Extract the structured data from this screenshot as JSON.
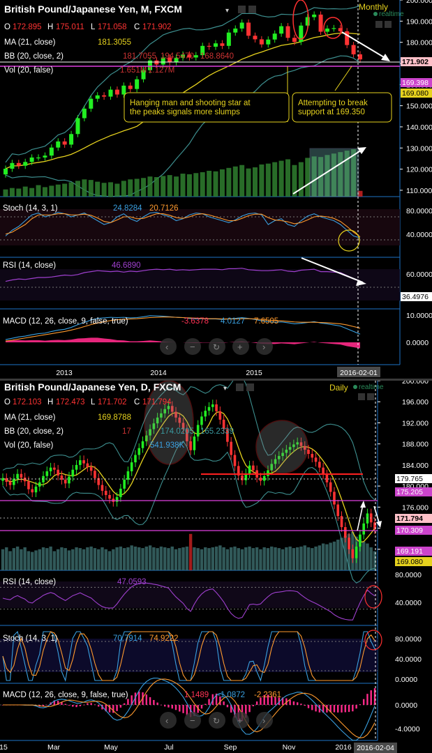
{
  "colors": {
    "up": "#22ee22",
    "down": "#ff3333",
    "ma": "#e6d21e",
    "bb": "#3d8f8f",
    "vol": "#2f8f2f",
    "stoch_k": "#3aa0e0",
    "stoch_d": "#ff9a2e",
    "rsi": "#a040d0",
    "macd_hist": "#ff2a8a",
    "support": "#ff2020",
    "level": "#e040e0",
    "note": "#e6d21e",
    "axis": "#1e73c8",
    "price_tag": "#ffc0c8"
  },
  "chart_data": [
    {
      "type": "candlestick",
      "title": "British Pound/Japanese Yen, M, FXCM",
      "timeframe_label": "Monthly",
      "realtime_label": "realtime",
      "ohlc": {
        "o_label": "O",
        "o": "172.895",
        "h_label": "H",
        "h": "175.011",
        "l_label": "L",
        "l": "171.058",
        "c_label": "C",
        "c": "171.902"
      },
      "indicators": {
        "ma": {
          "label": "MA (21, close)",
          "value": "181.3055"
        },
        "bb": {
          "label": "BB (20, close, 2)",
          "value1": "181.7055",
          "value2": "194.5470",
          "value3": "168.8640"
        },
        "vol": {
          "label": "Vol (20, false)",
          "value": "1.651M",
          "value2": "1.127M"
        }
      },
      "price_axis": {
        "ticks": [
          "200.000",
          "190.000",
          "180.000",
          "170.000",
          "160.000",
          "150.000",
          "140.000",
          "130.000",
          "120.000",
          "110.000"
        ],
        "min": 107,
        "max": 200
      },
      "price_tags": {
        "last": "171.902",
        "bb_lower": "169.398",
        "support": "169.080"
      },
      "x_ticks": [
        "2013",
        "2014",
        "2015"
      ],
      "date_tag": "2016-02-01",
      "annotations": [
        {
          "text_line1": "Hanging man and shooting star at",
          "text_line2": "the peaks signals more slumps"
        },
        {
          "text_line1": "Attempting to break",
          "text_line2": "support at 169.350"
        }
      ],
      "series": {
        "open": [
          117.5,
          120.2,
          122.9,
          121.6,
          123.4,
          125.5,
          125.5,
          126.4,
          130.2,
          133.1,
          131.6,
          136.6,
          144.1,
          148.6,
          153.3,
          154.9,
          154.3,
          157.6,
          155.3,
          159.5,
          157.9,
          162.5,
          166.8,
          171.4,
          169.5,
          172.8,
          170.6,
          172.7,
          174.2,
          172.8,
          173.9,
          178.3,
          177.9,
          179.5,
          178.3,
          184.6,
          186.5,
          189.3,
          183.1,
          181.4,
          179.0,
          181.3,
          184.1,
          187.6,
          182.1,
          180.2,
          187.9,
          191.9,
          193.1,
          185.0,
          186.5,
          186.7,
          185.2,
          178.7,
          174.3
        ],
        "close": [
          120.2,
          122.9,
          121.6,
          123.4,
          125.5,
          125.5,
          126.4,
          130.2,
          133.1,
          131.6,
          136.6,
          144.1,
          148.6,
          153.3,
          154.9,
          154.3,
          157.6,
          155.3,
          159.5,
          157.9,
          162.5,
          166.8,
          171.4,
          169.5,
          172.8,
          170.6,
          172.7,
          174.2,
          172.8,
          173.9,
          178.3,
          177.9,
          179.5,
          178.3,
          184.6,
          186.5,
          189.3,
          183.1,
          181.4,
          179.0,
          181.3,
          184.1,
          187.6,
          182.1,
          180.2,
          187.9,
          191.9,
          193.1,
          185.0,
          186.5,
          186.7,
          185.2,
          178.7,
          174.3,
          171.9
        ],
        "volume": [
          0.25,
          0.3,
          0.28,
          0.35,
          0.3,
          0.4,
          0.33,
          0.38,
          0.42,
          0.45,
          0.5,
          0.55,
          0.6,
          0.58,
          0.52,
          0.48,
          0.5,
          0.45,
          0.55,
          0.6,
          0.62,
          0.65,
          0.7,
          0.68,
          0.72,
          0.75,
          0.7,
          0.8,
          0.78,
          0.82,
          0.85,
          0.9,
          0.88,
          0.95,
          1.0,
          1.05,
          1.1,
          0.98,
          1.02,
          1.12,
          1.15,
          1.2,
          1.25,
          1.3,
          1.1,
          1.2,
          1.35,
          1.4,
          1.38,
          1.45,
          1.5,
          1.55,
          1.6,
          1.65,
          0.2
        ]
      },
      "stoch": {
        "label": "Stoch (14, 3, 1)",
        "k": "24.8284",
        "d": "20.7126",
        "ticks": [
          "80.0000",
          "40.0000"
        ],
        "k_vals": [
          30,
          45,
          55,
          70,
          85,
          90,
          80,
          85,
          92,
          88,
          80,
          85,
          90,
          80,
          70,
          60,
          65,
          80,
          88,
          75,
          68,
          80,
          90,
          92,
          85,
          80,
          70,
          75,
          85,
          90,
          88,
          80,
          75,
          70,
          65,
          72,
          82,
          88,
          90,
          85,
          60,
          70,
          75,
          60,
          55,
          70,
          82,
          88,
          80,
          75,
          70,
          60,
          45,
          30,
          25
        ],
        "d_vals": [
          35,
          40,
          50,
          60,
          75,
          85,
          85,
          85,
          88,
          88,
          85,
          85,
          87,
          84,
          77,
          68,
          65,
          72,
          80,
          80,
          75,
          76,
          82,
          88,
          88,
          84,
          78,
          76,
          80,
          86,
          88,
          85,
          80,
          75,
          70,
          70,
          76,
          83,
          87,
          87,
          78,
          72,
          70,
          67,
          62,
          65,
          72,
          80,
          82,
          80,
          76,
          68,
          55,
          40,
          28
        ]
      },
      "rsi": {
        "label": "RSI (14, close)",
        "value": "46.6890",
        "ticks": [
          "60.0000"
        ],
        "tag": "36.4976",
        "vals": [
          52,
          55,
          57,
          56,
          58,
          60,
          60,
          61,
          63,
          65,
          64,
          66,
          70,
          72,
          74,
          73,
          72,
          73,
          71,
          73,
          72,
          74,
          76,
          77,
          76,
          77,
          75,
          76,
          75,
          76,
          77,
          77,
          77,
          76,
          78,
          78,
          79,
          76,
          75,
          74,
          74,
          75,
          76,
          73,
          72,
          75,
          76,
          77,
          72,
          72,
          71,
          70,
          64,
          58,
          53
        ]
      },
      "macd": {
        "label": "MACD (12, 26, close, 9, false, true)",
        "v1": "-3.6378",
        "v2": "4.0127",
        "v3": "7.6505",
        "ticks": [
          "10.0000",
          "0.0000"
        ],
        "macd_vals": [
          1,
          1.5,
          2,
          2.3,
          2.8,
          3.2,
          3.4,
          4,
          4.5,
          4.8,
          5.5,
          6.5,
          7.3,
          8.2,
          8.8,
          9,
          9.2,
          9.1,
          9.2,
          9,
          9.1,
          9.4,
          9.8,
          9.7,
          9.6,
          9.4,
          9.2,
          9.1,
          8.8,
          8.6,
          8.7,
          8.6,
          8.6,
          8.4,
          8.6,
          8.8,
          9.1,
          8.8,
          8.4,
          7.9,
          7.6,
          7.4,
          7.5,
          7.2,
          6.8,
          7,
          7.3,
          7.6,
          7.1,
          6.8,
          6.4,
          6,
          5,
          4,
          3
        ],
        "signal_vals": [
          0.5,
          0.8,
          1.2,
          1.6,
          2,
          2.4,
          2.8,
          3.2,
          3.6,
          4,
          4.5,
          5.1,
          5.8,
          6.5,
          7.1,
          7.6,
          8,
          8.3,
          8.5,
          8.6,
          8.7,
          8.9,
          9.1,
          9.2,
          9.3,
          9.3,
          9.2,
          9.1,
          9,
          8.9,
          8.8,
          8.7,
          8.7,
          8.6,
          8.6,
          8.6,
          8.7,
          8.7,
          8.6,
          8.4,
          8.2,
          8,
          7.9,
          7.7,
          7.5,
          7.4,
          7.4,
          7.4,
          7.3,
          7.2,
          7,
          6.8,
          6.4,
          5.8,
          5.2
        ]
      }
    },
    {
      "type": "candlestick",
      "title": "British Pound/Japanese Yen, D, FXCM",
      "timeframe_label": "Daily",
      "realtime_label": "realtime",
      "ohlc": {
        "o_label": "O",
        "o": "172.103",
        "h_label": "H",
        "h": "172.473",
        "l_label": "L",
        "l": "171.702",
        "c_label": "C",
        "c": "171.794"
      },
      "indicators": {
        "ma": {
          "label": "MA (21, close)",
          "value": "169.8788"
        },
        "bb": {
          "label": "BB (20, close, 2)",
          "value1": "17",
          "value2": "174.0205",
          "value3": "165.2339"
        },
        "vol": {
          "label": "Vol (20, false)",
          "value": "541.938K"
        }
      },
      "price_axis": {
        "ticks": [
          "200.000",
          "196.000",
          "192.000",
          "188.000",
          "184.000",
          "180.000",
          "176.000",
          "172.000",
          "168.000"
        ],
        "min": 164,
        "max": 200
      },
      "price_tags": {
        "resistance": "179.765",
        "upper": "175.205",
        "last": "171.794",
        "support": "170.309",
        "lower1": "169.191",
        "lower2": "169.080"
      },
      "x_ticks": [
        "15",
        "Mar",
        "May",
        "Jul",
        "Sep",
        "Nov",
        "2016"
      ],
      "date_tag": "2016-02-04",
      "rsi": {
        "label": "RSI (14, close)",
        "value": "47.0593",
        "ticks": [
          "80.0000",
          "40.0000"
        ]
      },
      "stoch": {
        "label": "Stoch (14, 3, 1)",
        "k": "70.7914",
        "d": "74.9222",
        "ticks": [
          "80.0000",
          "40.0000",
          "0.0000"
        ]
      },
      "macd": {
        "label": "MACD (12, 26, close, 9, false, true)",
        "v1": "1.1489",
        "v2": "-1.0872",
        "v3": "-2.2361",
        "ticks": [
          "0.0000",
          "-4.0000"
        ]
      },
      "closes": [
        181.5,
        180.8,
        180.2,
        181.4,
        182.3,
        181.6,
        180.9,
        179.4,
        178.8,
        179.9,
        180.7,
        181.9,
        182.8,
        183.5,
        183.1,
        182.0,
        181.2,
        180.5,
        181.8,
        183.1,
        184.0,
        184.9,
        184.3,
        183.6,
        182.9,
        181.5,
        180.2,
        179.1,
        178.3,
        177.6,
        177.0,
        177.9,
        179.5,
        181.2,
        182.8,
        184.5,
        185.9,
        187.2,
        188.5,
        189.6,
        190.8,
        191.9,
        193.0,
        193.8,
        194.6,
        195.2,
        194.1,
        193.0,
        192.0,
        190.8,
        188.5,
        186.8,
        189.4,
        191.6,
        193.2,
        194.3,
        195.0,
        195.5,
        194.2,
        192.6,
        190.8,
        188.4,
        185.9,
        183.8,
        182.0,
        181.1,
        182.4,
        183.9,
        183.0,
        181.6,
        181.0,
        181.9,
        183.0,
        184.2,
        185.1,
        185.7,
        186.3,
        186.9,
        187.4,
        187.9,
        188.3,
        187.6,
        186.9,
        186.1,
        185.4,
        184.6,
        183.5,
        182.2,
        180.7,
        178.9,
        176.5,
        174.3,
        172.2,
        170.2,
        168.0,
        166.3,
        168.5,
        170.8,
        172.9,
        174.8,
        173.1,
        171.8
      ],
      "volume": [
        0.55,
        0.6,
        0.5,
        0.58,
        0.62,
        0.55,
        0.6,
        0.5,
        0.48,
        0.52,
        0.55,
        0.6,
        0.58,
        0.62,
        0.5,
        0.55,
        0.6,
        0.58,
        0.52,
        0.55,
        0.6,
        0.58,
        0.55,
        0.6,
        0.62,
        0.58,
        0.55,
        0.6,
        0.55,
        0.5,
        0.55,
        0.6,
        0.62,
        0.58,
        0.6,
        0.65,
        0.62,
        0.6,
        0.58,
        0.62,
        0.65,
        0.6,
        0.58,
        0.62,
        0.6,
        0.58,
        0.62,
        0.55,
        0.58,
        0.6,
        0.62,
        0.95,
        0.6,
        0.58,
        0.55,
        0.6,
        0.58,
        0.6,
        0.62,
        0.65,
        0.6,
        0.55,
        0.6,
        0.62,
        0.58,
        0.55,
        0.6,
        0.62,
        0.58,
        0.6,
        0.55,
        0.6,
        0.58,
        0.62,
        0.6,
        0.58,
        0.55,
        0.6,
        0.62,
        0.58,
        0.6,
        0.62,
        0.65,
        0.6,
        0.58,
        0.62,
        0.65,
        0.7,
        0.68,
        0.72,
        0.75,
        0.8,
        0.85,
        0.9,
        0.95,
        1.0,
        0.88,
        0.8,
        0.75,
        0.7,
        0.6,
        0.5
      ]
    }
  ]
}
